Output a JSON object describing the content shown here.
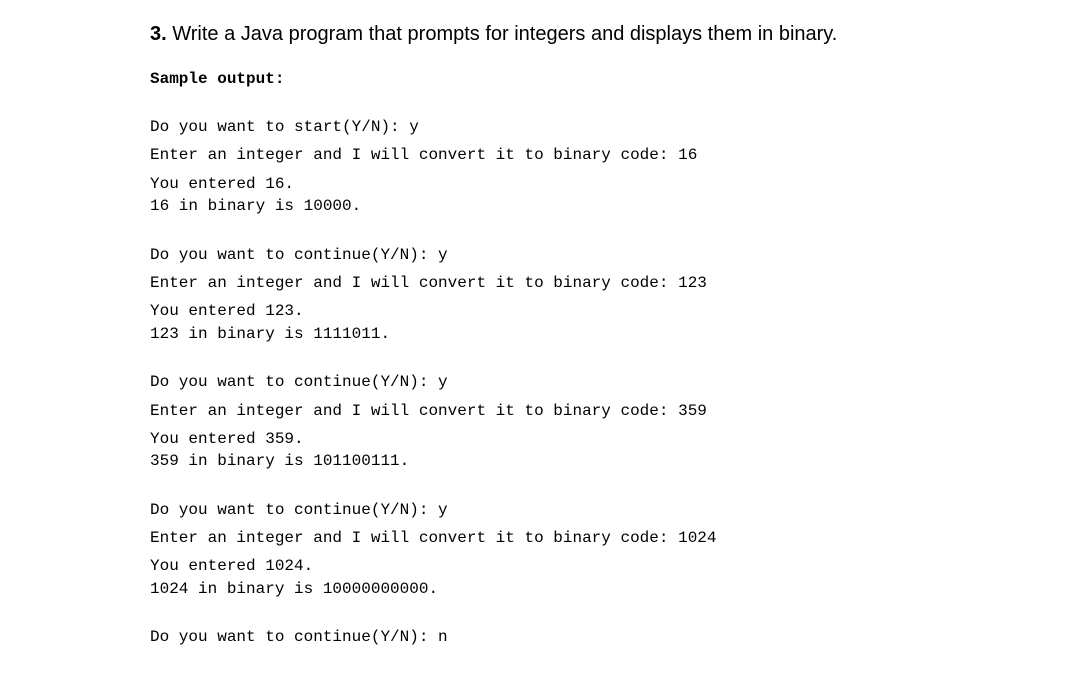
{
  "question": {
    "number": "3.",
    "text": "Write a Java program that prompts for integers and displays them in binary."
  },
  "sample_label": "Sample output:",
  "runs": [
    {
      "prompt_line": "Do you want to start(Y/N): y",
      "enter_line": "Enter an integer and I will convert it to binary code: 16",
      "echo_line": "You entered 16.",
      "result_line": "16 in binary is 10000."
    },
    {
      "prompt_line": "Do you want to continue(Y/N): y",
      "enter_line": "Enter an integer and I will convert it to binary code: 123",
      "echo_line": "You entered 123.",
      "result_line": "123 in binary is 1111011."
    },
    {
      "prompt_line": "Do you want to continue(Y/N): y",
      "enter_line": "Enter an integer and I will convert it to binary code: 359",
      "echo_line": "You entered 359.",
      "result_line": "359 in binary is 101100111."
    },
    {
      "prompt_line": "Do you want to continue(Y/N): y",
      "enter_line": "Enter an integer and I will convert it to binary code: 1024",
      "echo_line": "You entered 1024.",
      "result_line": "1024 in binary is 10000000000."
    }
  ],
  "final_line": "Do you want to continue(Y/N): n"
}
